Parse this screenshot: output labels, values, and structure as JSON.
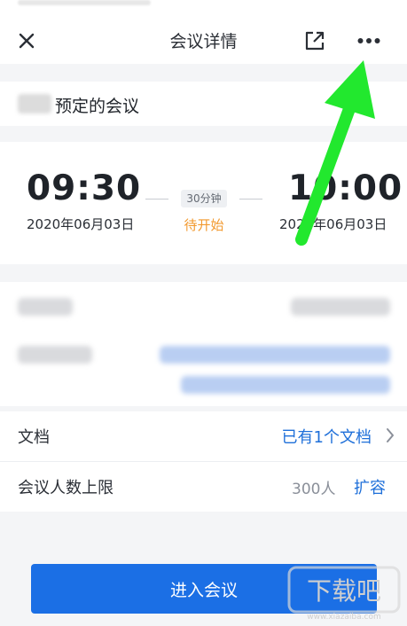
{
  "header": {
    "title": "会议详情",
    "icons": [
      "close-icon",
      "share-icon",
      "more-icon"
    ]
  },
  "organizer": {
    "suffix": "预定的会议"
  },
  "schedule": {
    "start_time": "09:30",
    "start_date": "2020年06月03日",
    "end_time": "10:00",
    "end_date": "2020年06月03日",
    "duration": "30分钟",
    "status": "待开始"
  },
  "documents": {
    "label": "文档",
    "value": "已有1个文档"
  },
  "participants": {
    "label": "会议人数上限",
    "value": "300人",
    "action": "扩容"
  },
  "primary_action": {
    "label": "进入会议"
  },
  "colors": {
    "primary": "#1B6FE5",
    "link": "#1E6FD9",
    "status_pending": "#F2992E",
    "annotation_arrow": "#22E82E"
  },
  "watermark": {
    "brand": "下载吧",
    "url": "www.xiazaiba.com"
  }
}
